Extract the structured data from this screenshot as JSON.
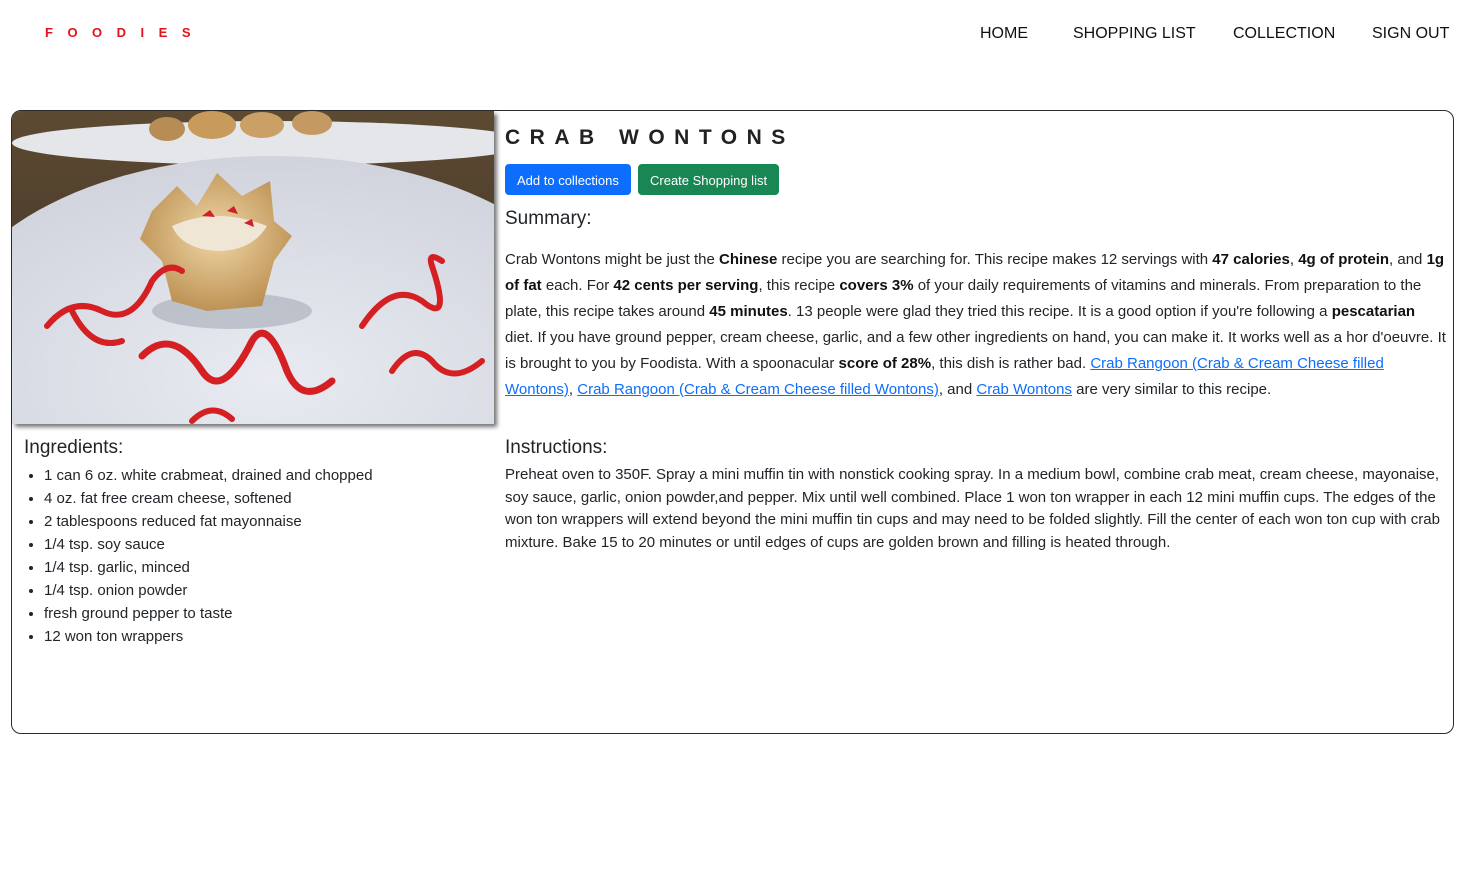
{
  "brand": "FOODIES",
  "nav": {
    "home": "HOME",
    "shopping_list": "SHOPPING LIST",
    "collection": "COLLECTION",
    "sign_out": "SIGN OUT"
  },
  "recipe": {
    "title": "CRAB WONTONS",
    "add_to_collections": "Add to collections",
    "create_shopping_list": "Create Shopping list",
    "summary_heading": "Summary:",
    "summary": {
      "t1": "Crab Wontons might be just the ",
      "b1": "Chinese",
      "t2": " recipe you are searching for. This recipe makes 12 servings with ",
      "b2": "47 calories",
      "t3": ", ",
      "b3": "4g of protein",
      "t4": ", and ",
      "b4": "1g of fat",
      "t5": " each. For ",
      "b5": "42 cents per serving",
      "t6": ", this recipe ",
      "b6": "covers 3%",
      "t7": " of your daily requirements of vitamins and minerals. From preparation to the plate, this recipe takes around ",
      "b7": "45 minutes",
      "t8": ". 13 people were glad they tried this recipe. It is a good option if you're following a ",
      "b8": "pescatarian",
      "t9": " diet. If you have ground pepper, cream cheese, garlic, and a few other ingredients on hand, you can make it. It works well as a hor d'oeuvre. It is brought to you by Foodista. With a spoonacular ",
      "b9": "score of 28%",
      "t10": ", this dish is rather bad. ",
      "link1": "Crab Rangoon (Crab & Cream Cheese filled Wontons)",
      "t11": ", ",
      "link2": "Crab Rangoon (Crab & Cream Cheese filled Wontons)",
      "t12": ", and ",
      "link3": "Crab Wontons",
      "t13": " are very similar to this recipe."
    },
    "ingredients_heading": "Ingredients:",
    "ingredients": [
      "1 can 6 oz. white crabmeat, drained and chopped",
      "4 oz. fat free cream cheese, softened",
      "2 tablespoons reduced fat mayonnaise",
      "1/4 tsp. soy sauce",
      "1/4 tsp. garlic, minced",
      "1/4 tsp. onion powder",
      "fresh ground pepper to taste",
      "12 won ton wrappers"
    ],
    "instructions_heading": "Instructions:",
    "instructions": "Preheat oven to 350F. Spray a mini muffin tin with nonstick cooking spray. In a medium bowl, combine crab meat, cream cheese, mayonaise, soy sauce, garlic, onion powder,and pepper. Mix until well combined. Place 1 won ton wrapper in each 12 mini muffin cups. The edges of the won ton wrappers will extend beyond the mini muffin tin cups and may need to be folded slightly. Fill the center of each won ton cup with crab mixture. Bake 15 to 20 minutes or until edges of cups are golden brown and filling is heated through."
  },
  "colors": {
    "brand": "#e0141e",
    "primary_button": "#0d6efd",
    "success_button": "#198754",
    "link": "#0d6efd"
  }
}
